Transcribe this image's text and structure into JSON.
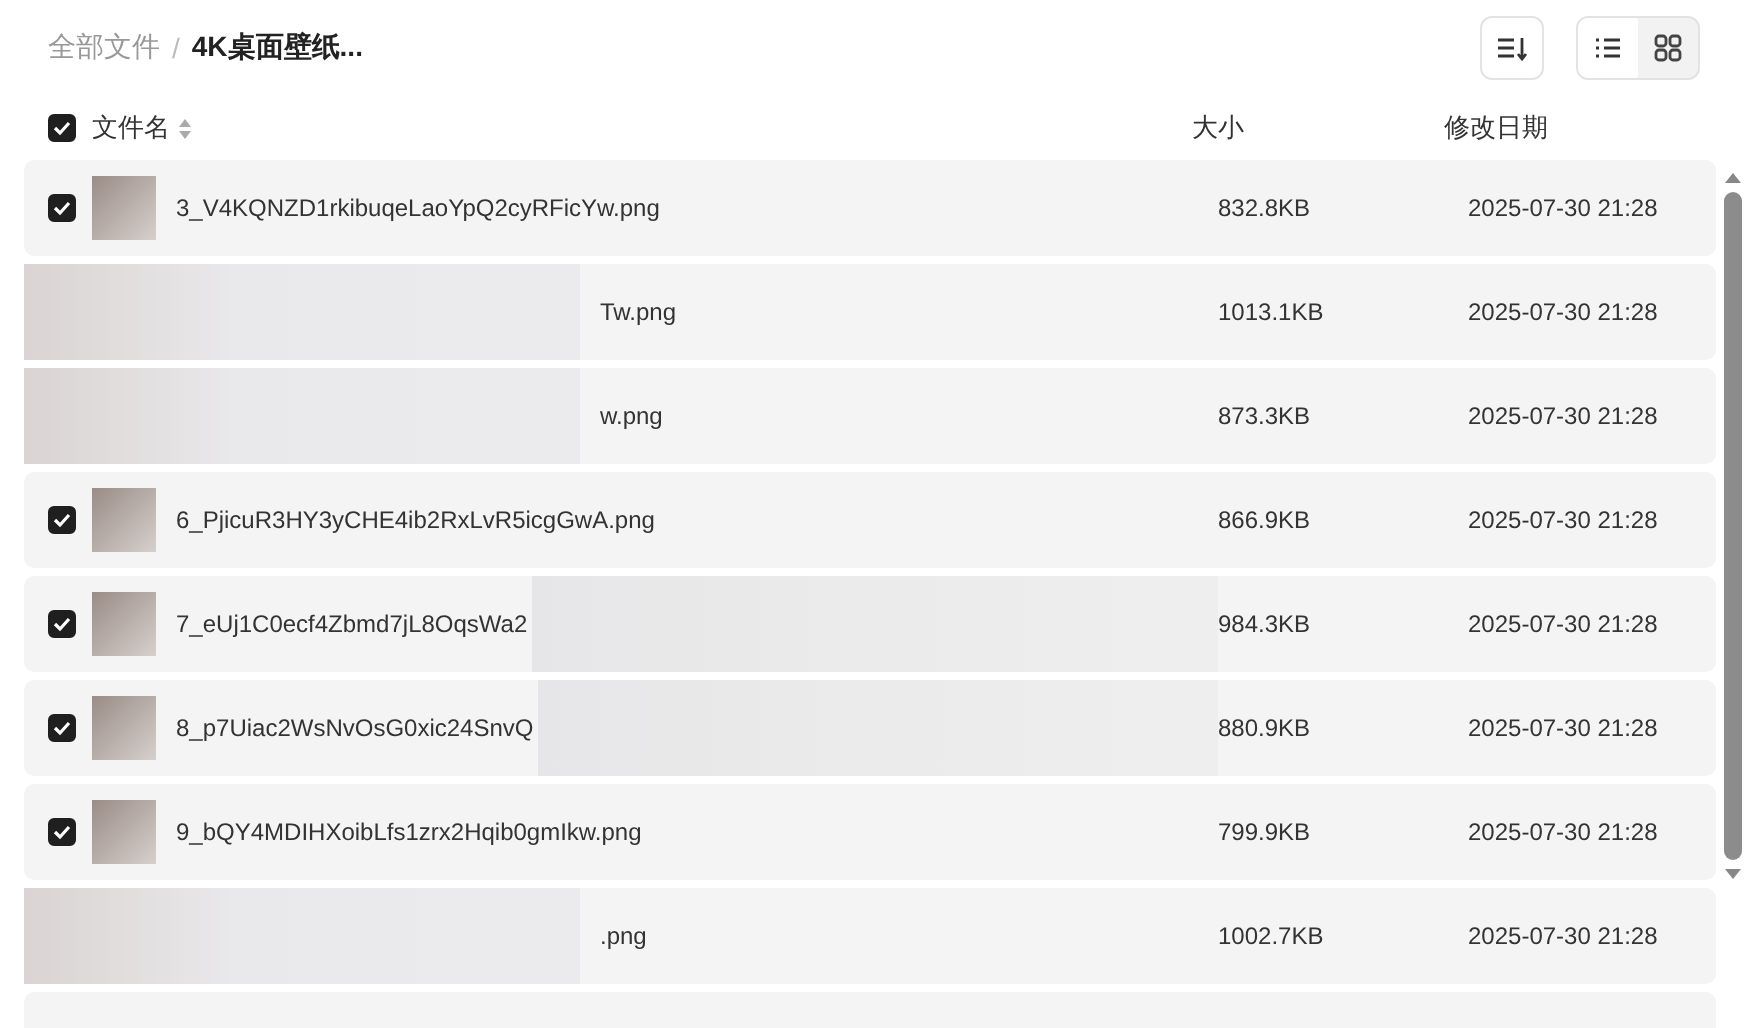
{
  "breadcrumb": {
    "separator": "/",
    "items": [
      {
        "label": "全部文件",
        "current": false
      },
      {
        "label": "4K桌面壁纸...",
        "current": true
      }
    ]
  },
  "view_toggle": [
    {
      "kind": "list",
      "selected": true
    },
    {
      "kind": "grid",
      "selected": false
    }
  ],
  "header": {
    "checked": true,
    "columns": [
      "文件名",
      "大小",
      "修改日期"
    ]
  },
  "rows": [
    {
      "kind": "file",
      "checked": true,
      "name": "3_V4KQNZD1rkibuqeLaoYpQ2cyRFicYw.png",
      "size": "832.8KB",
      "modified": "2025-07-30 21:28"
    },
    {
      "kind": "blurred_left",
      "name": "Tw.png",
      "size": "1013.1KB",
      "modified": "2025-07-30 21:28"
    },
    {
      "kind": "blurred_left",
      "name": "w.png",
      "size": "873.3KB",
      "modified": "2025-07-30 21:28"
    },
    {
      "kind": "file",
      "checked": true,
      "name": "6_PjicuR3HY3yCHE4ib2RxLvR5icgGwA.png",
      "size": "866.9KB",
      "modified": "2025-07-30 21:28"
    },
    {
      "kind": "blurred_right",
      "checked": true,
      "name": "7_eUj1C0ecf4Zbmd7jL8OqsWa2",
      "size": "984.3KB",
      "modified": "2025-07-30 21:28"
    },
    {
      "kind": "blurred_right",
      "checked": true,
      "name": "8_p7Uiac2WsNvOsG0xic24SnvQ",
      "size": "880.9KB",
      "modified": "2025-07-30 21:28"
    },
    {
      "kind": "file",
      "checked": true,
      "name": "9_bQY4MDIHXoibLfs1zrx2Hqib0gmIkw.png",
      "size": "799.9KB",
      "modified": "2025-07-30 21:28"
    },
    {
      "kind": "blurred_left",
      "name": ".png",
      "size": "1002.7KB",
      "modified": "2025-07-30 21:28"
    }
  ]
}
